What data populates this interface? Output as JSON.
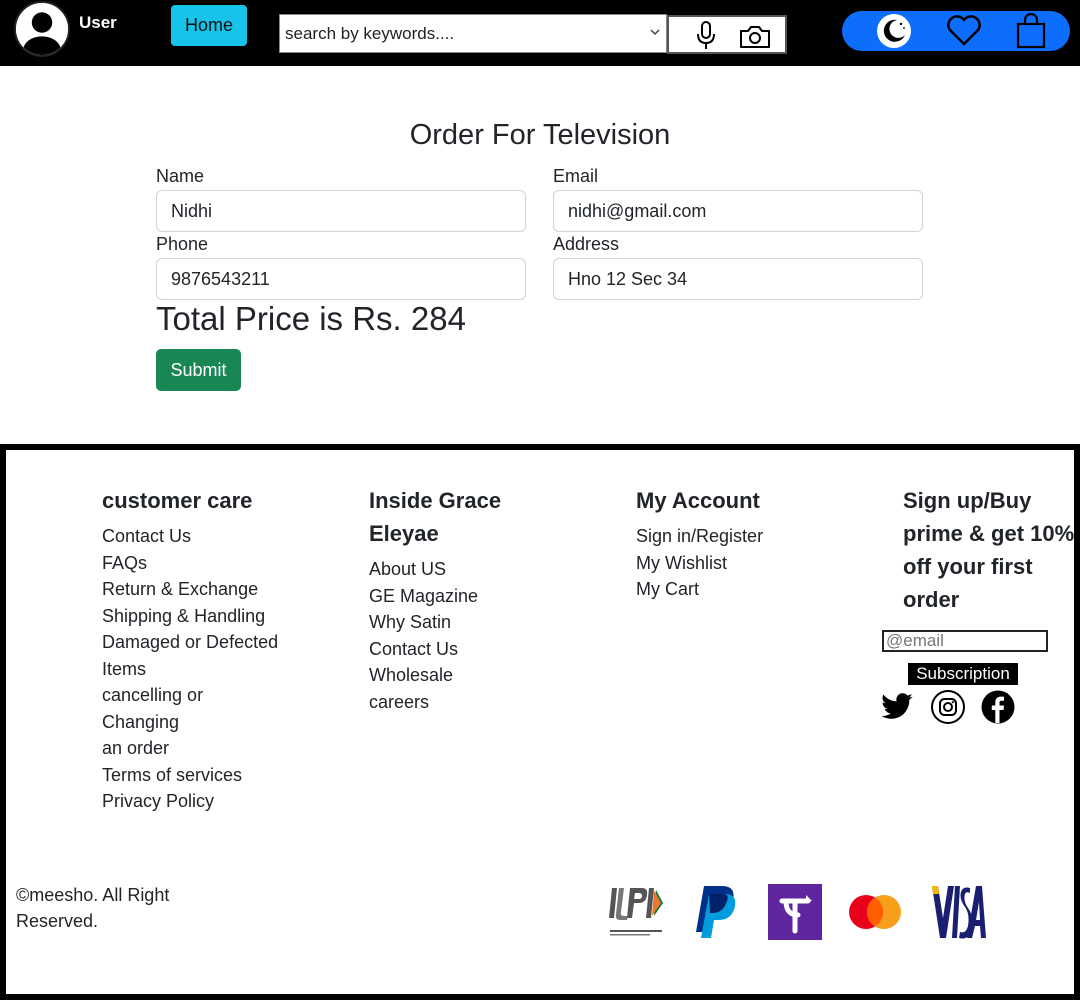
{
  "header": {
    "user_label": "User",
    "home_label": "Home",
    "search_placeholder": "search by keywords....",
    "icons": [
      "avatar-icon",
      "chevron-down-icon",
      "microphone-icon",
      "camera-icon",
      "moon-icon",
      "heart-icon",
      "shopping-bag-icon"
    ]
  },
  "form": {
    "title": "Order For Television",
    "name_label": "Name",
    "name_value": "Nidhi",
    "email_label": "Email",
    "email_value": "nidhi@gmail.com",
    "phone_label": "Phone",
    "phone_value": "9876543211",
    "address_label": "Address",
    "address_value": "Hno 12 Sec 34",
    "total_text": "Total Price is Rs. 284",
    "submit_label": "Submit"
  },
  "footer": {
    "customer_care": {
      "heading": "customer care",
      "items": [
        "Contact Us",
        "FAQs",
        "Return & Exchange",
        "Shipping & Handling",
        "Damaged or Defected",
        "Items",
        "cancelling or",
        "Changing",
        "an order",
        "Terms of services",
        "Privacy Policy"
      ]
    },
    "inside": {
      "heading": "Inside Grace Eleyae",
      "items": [
        "About US",
        "GE Magazine",
        "Why Satin",
        "Contact Us",
        "Wholesale",
        "careers"
      ]
    },
    "account": {
      "heading": "My Account",
      "items": [
        "Sign in/Register",
        "My Wishlist",
        "My Cart"
      ]
    },
    "signup": {
      "heading": "Sign up/Buy prime & get 10% off your first order",
      "email_placeholder": "@email",
      "subscribe_label": "Subscription"
    },
    "social_icons": [
      "twitter-icon",
      "instagram-icon",
      "facebook-icon"
    ],
    "copyright": "©meesho. All Right Reserved.",
    "payment_logos": [
      "upi-logo",
      "paypal-logo",
      "phonepe-logo",
      "mastercard-logo",
      "visa-logo"
    ],
    "colors": {
      "home_button": "#17c3e8",
      "action_pill": "#0d6efd",
      "submit_button": "#198754",
      "phonepe": "#5f259f",
      "mastercard_red": "#eb001b",
      "mastercard_orange": "#f79e1b",
      "visa_blue": "#1a1f71",
      "paypal_dark": "#003087",
      "paypal_light": "#009cde"
    }
  }
}
